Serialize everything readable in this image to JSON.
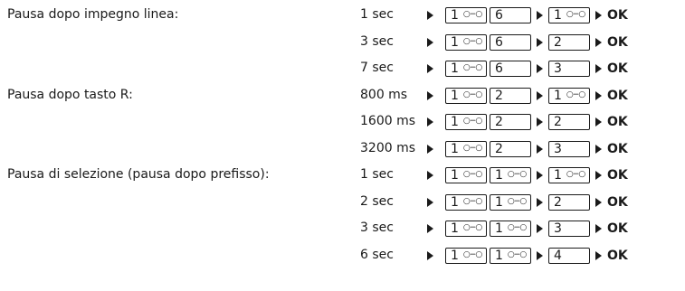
{
  "sections": [
    {
      "label": "Pausa dopo impegno linea:",
      "options": [
        {
          "value": "1 sec",
          "keys": [
            "1",
            "6"
          ],
          "select": "1",
          "ok": "OK"
        },
        {
          "value": "3 sec",
          "keys": [
            "1",
            "6"
          ],
          "select": "2",
          "ok": "OK"
        },
        {
          "value": "7 sec",
          "keys": [
            "1",
            "6"
          ],
          "select": "3",
          "ok": "OK"
        }
      ]
    },
    {
      "label": "Pausa dopo tasto R:",
      "options": [
        {
          "value": "800 ms",
          "keys": [
            "1",
            "2"
          ],
          "select": "1",
          "ok": "OK"
        },
        {
          "value": "1600 ms",
          "keys": [
            "1",
            "2"
          ],
          "select": "2",
          "ok": "OK"
        },
        {
          "value": "3200 ms",
          "keys": [
            "1",
            "2"
          ],
          "select": "3",
          "ok": "OK"
        }
      ]
    },
    {
      "label": "Pausa di selezione (pausa dopo prefisso):",
      "options": [
        {
          "value": "1 sec",
          "keys": [
            "1",
            "1"
          ],
          "select": "1",
          "ok": "OK"
        },
        {
          "value": "2 sec",
          "keys": [
            "1",
            "1"
          ],
          "select": "2",
          "ok": "OK"
        },
        {
          "value": "3 sec",
          "keys": [
            "1",
            "1"
          ],
          "select": "3",
          "ok": "OK"
        },
        {
          "value": "6 sec",
          "keys": [
            "1",
            "1"
          ],
          "select": "4",
          "ok": "OK"
        }
      ]
    }
  ],
  "icons": {
    "voicemail_glyph": "voicemail-icon",
    "arrow": "triangle-right-icon"
  }
}
